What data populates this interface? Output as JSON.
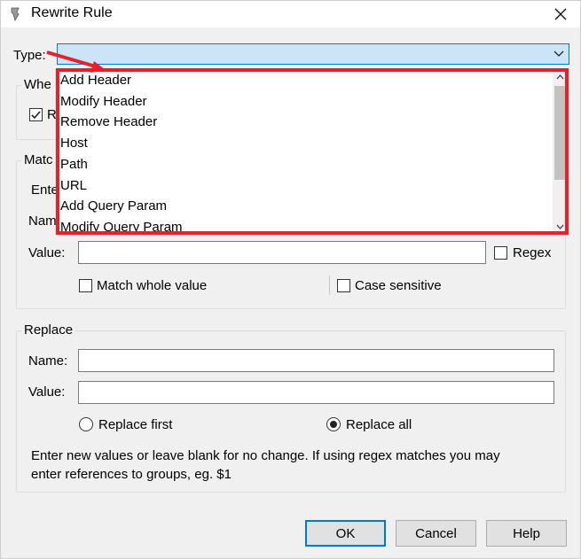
{
  "window": {
    "title": "Rewrite Rule",
    "icon": "app-icon",
    "close_icon": "close-icon"
  },
  "type_field": {
    "label": "Type:",
    "selected_value": "",
    "arrow_icon": "chevron-down-icon"
  },
  "dropdown": {
    "options": [
      "Add Header",
      "Modify Header",
      "Remove Header",
      "Host",
      "Path",
      "URL",
      "Add Query Param",
      "Modify Query Param"
    ],
    "scroll_up_icon": "chevron-up-icon",
    "scroll_down_icon": "chevron-down-icon"
  },
  "where_group": {
    "title": "Whe",
    "checkbox_label": "R",
    "checked": true
  },
  "match_group": {
    "title": "Matc",
    "enter_label": "Ente",
    "name_label": "Nam",
    "value_label": "Value:",
    "regex_label": "Regex",
    "match_whole_label": "Match whole value",
    "case_sensitive_label": "Case sensitive"
  },
  "replace_group": {
    "title": "Replace",
    "name_label": "Name:",
    "value_label": "Value:",
    "replace_first_label": "Replace first",
    "replace_all_label": "Replace all",
    "selected": "replace_all",
    "hint": "Enter new values or leave blank for no change. If using regex matches you may",
    "hint2": "enter references to groups, eg. $1"
  },
  "buttons": {
    "ok": "OK",
    "cancel": "Cancel",
    "help": "Help"
  },
  "colors": {
    "highlight": "#e8202a",
    "accent": "#0078d7",
    "combo_bg": "#cce4f7"
  }
}
